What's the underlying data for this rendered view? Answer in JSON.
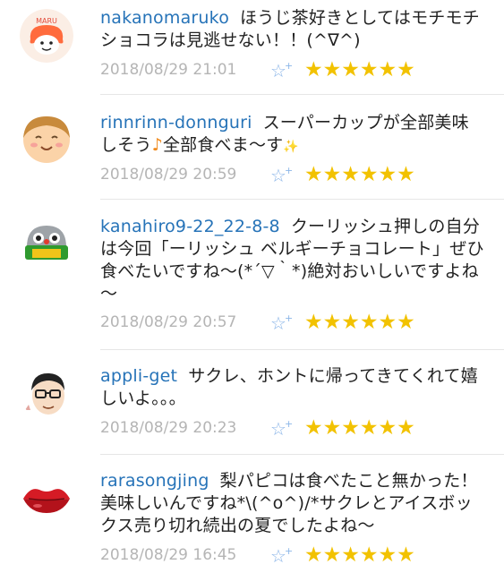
{
  "comments": [
    {
      "user": "nakanomaruko",
      "text": "ほうじ茶好きとしてはモチモチショコラは見逃せない！！(^∇^)",
      "timestamp": "2018/08/29 21:01",
      "avatar": "maru-face-avatar",
      "stars": "★★★★★★"
    },
    {
      "user": "rinnrinn-donnguri",
      "text": "スーパーカップが全部美味しそう",
      "text_note": "♪",
      "text_after": "全部食べま～す",
      "text_sparkle": "✨",
      "timestamp": "2018/08/29 20:59",
      "avatar": "smiling-face-avatar",
      "stars": "★★★★★★"
    },
    {
      "user": "kanahiro9-22_22-8-8",
      "text": "クーリッシュ押しの自分は今回「ーリッシュ ベルギーチョコレート」ぜひ食べたいですね～(*´▽｀*)絶対おいしいですよね～",
      "timestamp": "2018/08/29 20:57",
      "avatar": "robot-avatar",
      "stars": "★★★★★★"
    },
    {
      "user": "appli-get",
      "text": "サクレ、ホントに帰ってきてくれて嬉しいよ。。。",
      "timestamp": "2018/08/29 20:23",
      "avatar": "glasses-man-avatar",
      "stars": "★★★★★★"
    },
    {
      "user": "rarasongjing",
      "text": "梨パピコは食べたこと無かった！美味しいんですね*\\(^o^)/*サクレとアイスボックス売り切れ続出の夏でしたよね～",
      "timestamp": "2018/08/29 16:45",
      "avatar": "lips-avatar",
      "stars": "★★★★★★"
    }
  ],
  "add_star_icon": "☆",
  "add_star_plus": "+",
  "colors": {
    "username": "#2673b8",
    "timestamp": "#b5b5b5",
    "star": "#f2c200",
    "add_star": "#8cb6e8"
  }
}
